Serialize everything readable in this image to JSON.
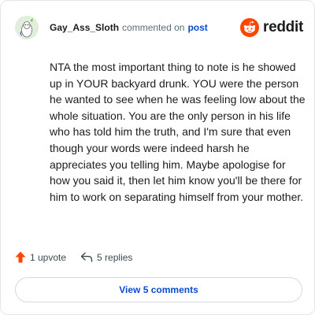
{
  "header": {
    "username": "Gay_Ass_Sloth",
    "commented_text": "commented on",
    "post_link": "post",
    "brand": "reddit"
  },
  "comment": {
    "body": "NTA the most important thing to note is he showed up in YOUR backyard drunk. YOU were the person he wanted to see when he was feeling low about the whole situation. You are the only person in his life who has told him the truth, and I'm sure that even though your words were indeed harsh he appreciates you telling him. Maybe apologise for how you said it, then let him know you'll be there for him to work on separating himself from your mother."
  },
  "actions": {
    "upvote_label": "1 upvote",
    "replies_label": "5 replies"
  },
  "footer": {
    "view_comments_label": "View 5 comments"
  },
  "colors": {
    "upvote_accent": "#ff4500",
    "link_blue": "#0a4ad4",
    "reddit_orange": "#ff4500"
  },
  "icons": {
    "avatar": "snoo-avatar-icon",
    "brand": "reddit-logo-icon",
    "upvote": "upvote-arrow-icon",
    "reply": "reply-arrow-icon"
  }
}
